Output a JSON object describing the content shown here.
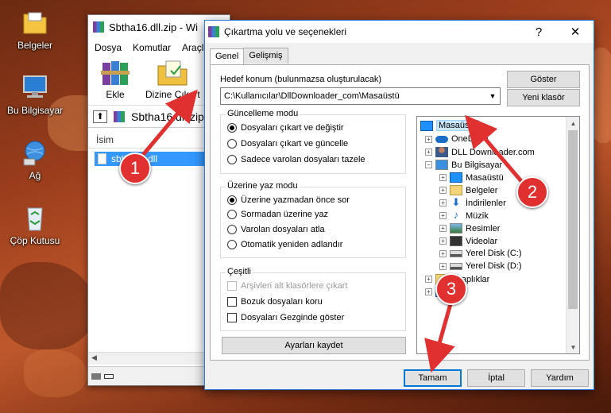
{
  "desktop": {
    "icons": [
      {
        "label": "Belgeler",
        "icon": "folder-icon"
      },
      {
        "label": "Bu Bilgisayar",
        "icon": "computer-icon"
      },
      {
        "label": "Ağ",
        "icon": "network-icon"
      },
      {
        "label": "Çöp Kutusu",
        "icon": "recycle-bin-icon"
      }
    ]
  },
  "winrar": {
    "title": "Sbtha16.dll.zip - Wi",
    "menu": [
      "Dosya",
      "Komutlar",
      "Araçla"
    ],
    "toolbar": {
      "add_label": "Ekle",
      "extract_label": "Dizine Çıkart"
    },
    "path_label": "Sbtha16.dll.zip",
    "list_header": "İsim",
    "selected_file": "sbtha16.dll"
  },
  "dialog": {
    "title": "Çıkartma yolu ve seçenekleri",
    "help": "?",
    "close": "✕",
    "tabs": [
      "Genel",
      "Gelişmiş"
    ],
    "destination_label": "Hedef konum (bulunmazsa oluşturulacak)",
    "destination_value": "C:\\Kullanıcılar\\DllDownloader_com\\Masaüstü",
    "show_button": "Göster",
    "new_folder_button": "Yeni klasör",
    "update_mode": {
      "title": "Güncelleme modu",
      "options": [
        "Dosyaları çıkart ve değiştir",
        "Dosyaları çıkart ve güncelle",
        "Sadece varolan dosyaları tazele"
      ],
      "selected": 0
    },
    "overwrite_mode": {
      "title": "Üzerine yaz modu",
      "options": [
        "Üzerine yazmadan önce sor",
        "Sormadan üzerine yaz",
        "Varolan dosyaları atla",
        "Otomatik yeniden adlandır"
      ],
      "selected": 0
    },
    "misc": {
      "title": "Çeşitli",
      "options": [
        "Arşivleri alt klasörlere çıkart",
        "Bozuk dosyaları koru",
        "Dosyaları Gezginde göster"
      ],
      "disabled": [
        true,
        false,
        false
      ]
    },
    "save_settings_button": "Ayarları kaydet",
    "tree": {
      "root": "Masaüstü",
      "items": [
        "OneDrive",
        "DLL Downloader.com",
        "Bu Bilgisayar",
        "Masaüstü",
        "Belgeler",
        "İndirilenler",
        "Müzik",
        "Resimler",
        "Videolar",
        "Yerel Disk (C:)",
        "Yerel Disk (D:)",
        "Kitaplıklar",
        "Ağ"
      ]
    },
    "ok_button": "Tamam",
    "cancel_button": "İptal",
    "help_button": "Yardım"
  },
  "annotations": {
    "step1": "1",
    "step2": "2",
    "step3": "3"
  },
  "colors": {
    "accent": "#0078d7",
    "selection": "#cce8ff",
    "badge": "#e03030"
  }
}
